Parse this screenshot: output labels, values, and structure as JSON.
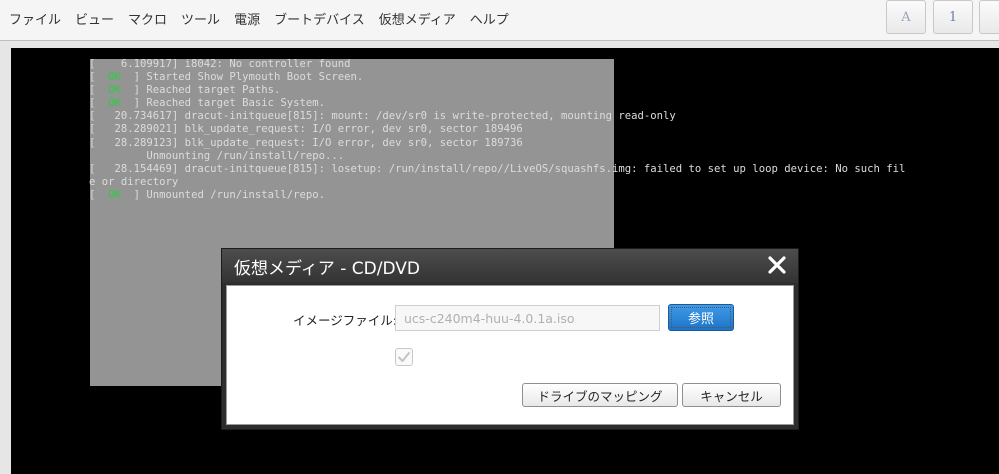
{
  "menubar": {
    "items": [
      "ファイル",
      "ビュー",
      "マクロ",
      "ツール",
      "電源",
      "ブートデバイス",
      "仮想メディア",
      "ヘルプ"
    ],
    "keyboard_buttons": [
      "A",
      "1",
      ""
    ]
  },
  "console": {
    "log_lines": [
      {
        "prefix": "[    6.109917] ",
        "ok": "",
        "text": "i8042: No controller found"
      },
      {
        "prefix": "[  ",
        "ok": "OK",
        "text": "  ] Started Show Plymouth Boot Screen."
      },
      {
        "prefix": "[  ",
        "ok": "OK",
        "text": "  ] Reached target Paths."
      },
      {
        "prefix": "[  ",
        "ok": "OK",
        "text": "  ] Reached target Basic System."
      },
      {
        "prefix": "[   20.734617] ",
        "ok": "",
        "text": "dracut-initqueue[815]: mount: /dev/sr0 is write-protected, mounting read-only"
      },
      {
        "prefix": "[   28.289021] ",
        "ok": "",
        "text": "blk_update_request: I/O error, dev sr0, sector 189496"
      },
      {
        "prefix": "[   28.289123] ",
        "ok": "",
        "text": "blk_update_request: I/O error, dev sr0, sector 189736"
      },
      {
        "prefix": "         ",
        "ok": "",
        "text": "Unmounting /run/install/repo..."
      },
      {
        "prefix": "[   28.154469] ",
        "ok": "",
        "text": "dracut-initqueue[815]: losetup: /run/install/repo//LiveOS/squashfs.img: failed to set up loop device: No such fil"
      },
      {
        "prefix": "",
        "ok": "",
        "text": "e or directory"
      },
      {
        "prefix": "[  ",
        "ok": "OK",
        "text": "  ] Unmounted /run/install/repo."
      }
    ]
  },
  "dialog": {
    "title": "仮想メディア - CD/DVD",
    "close_symbol": "✕",
    "file_label": "イメージファイル:",
    "file_value": "ucs-c240m4-huu-4.0.1a.iso",
    "browse_label": "参照",
    "checkbox_checked": true,
    "map_drive_label": "ドライブのマッピング",
    "cancel_label": "キャンセル"
  },
  "colors": {
    "accent": "#1f73c7",
    "ok_green": "#2ecc40"
  }
}
